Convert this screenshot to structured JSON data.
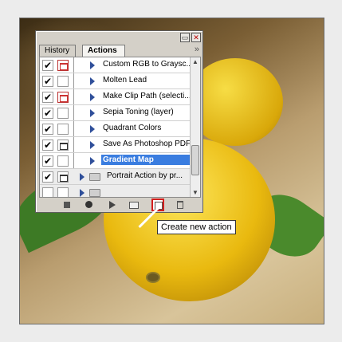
{
  "panel": {
    "tabs": [
      {
        "label": "History",
        "active": false
      },
      {
        "label": "Actions",
        "active": true
      }
    ],
    "menu_icon": "double-chevron-right-icon",
    "window_buttons": [
      "minimize-icon",
      "close-icon"
    ]
  },
  "actions": [
    {
      "label": "Custom RGB to Graysc...",
      "checked": true,
      "dialog": "red",
      "type": "action"
    },
    {
      "label": "Molten Lead",
      "checked": true,
      "dialog": "none",
      "type": "action"
    },
    {
      "label": "Make Clip Path (selecti...",
      "checked": true,
      "dialog": "red",
      "type": "action"
    },
    {
      "label": "Sepia Toning (layer)",
      "checked": true,
      "dialog": "none",
      "type": "action"
    },
    {
      "label": "Quadrant Colors",
      "checked": true,
      "dialog": "none",
      "type": "action"
    },
    {
      "label": "Save As Photoshop PDF",
      "checked": true,
      "dialog": "on",
      "type": "action"
    },
    {
      "label": "Gradient Map",
      "checked": true,
      "dialog": "none",
      "type": "action",
      "selected": true
    },
    {
      "label": "Portrait Action by pr...",
      "checked": true,
      "dialog": "on",
      "type": "set"
    }
  ],
  "toolbar": {
    "buttons": [
      "stop-icon",
      "record-icon",
      "play-icon",
      "new-set-icon",
      "new-action-icon",
      "delete-icon"
    ]
  },
  "tooltip": {
    "text": "Create new action"
  },
  "colors": {
    "selection": "#3a7de0",
    "highlight": "#d41e1e"
  }
}
